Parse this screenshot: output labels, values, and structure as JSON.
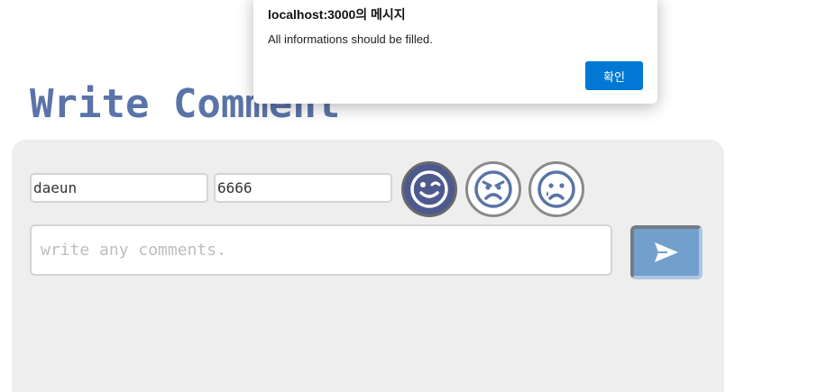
{
  "page": {
    "title": "Write Comment"
  },
  "form": {
    "name_value": "daeun",
    "password_value": "6666",
    "comment_placeholder": "write any comments.",
    "emotions": [
      {
        "icon": "wink-face-icon",
        "selected": true
      },
      {
        "icon": "angry-face-icon",
        "selected": false
      },
      {
        "icon": "sad-face-icon",
        "selected": false
      }
    ],
    "send_icon": "send-icon"
  },
  "dialog": {
    "title": "localhost:3000의 메시지",
    "message": "All informations should be filled.",
    "ok_label": "확인"
  },
  "colors": {
    "title": "#5a74a8",
    "panel": "#eeeeee",
    "selected_emotion": "#4e5a8e",
    "emoji_blue": "#5a74a8",
    "send_button": "#739fcd",
    "dialog_button": "#0078d4"
  }
}
